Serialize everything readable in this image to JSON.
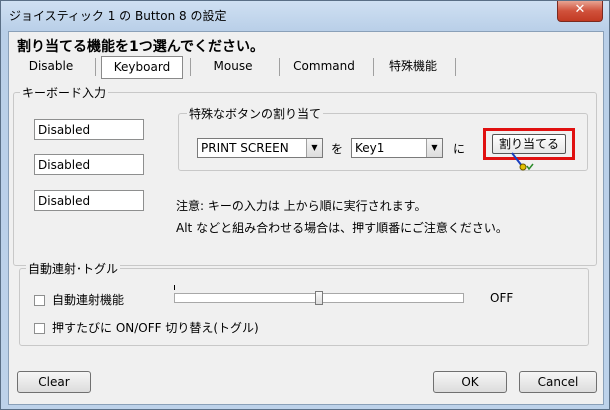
{
  "window": {
    "title": "ジョイスティック 1 の Button 8 の設定",
    "close_label": "✕"
  },
  "header": {
    "text": "割り当てる機能を1つ選んでください。"
  },
  "tabs": [
    {
      "label": "Disable"
    },
    {
      "label": "Keyboard"
    },
    {
      "label": "Mouse"
    },
    {
      "label": "Command"
    },
    {
      "label": "特殊機能"
    }
  ],
  "keyboard_group": {
    "label": "キーボード入力",
    "fields": [
      "Disabled",
      "Disabled",
      "Disabled"
    ],
    "special": {
      "label": "特殊なボタンの割り当て",
      "key_combo": "PRINT SCREEN",
      "wo": "を",
      "target_combo": "Key1",
      "ni": "に",
      "assign_button": "割り当てる"
    },
    "note1": "注意: キーの入力は 上から順に実行されます。",
    "note2": "Alt などと組み合わせる場合は、押す順番にご注意ください。"
  },
  "auto_group": {
    "label": "自動連射･トグル",
    "auto_fire_label": "自動連射機能",
    "slider_value_text": "OFF",
    "slider_level": 0.5,
    "toggle_label": "押すたびに ON/OFF 切り替え(トグル)"
  },
  "footer": {
    "clear": "Clear",
    "ok": "OK",
    "cancel": "Cancel"
  },
  "accent": {
    "highlight": "#e01010"
  }
}
